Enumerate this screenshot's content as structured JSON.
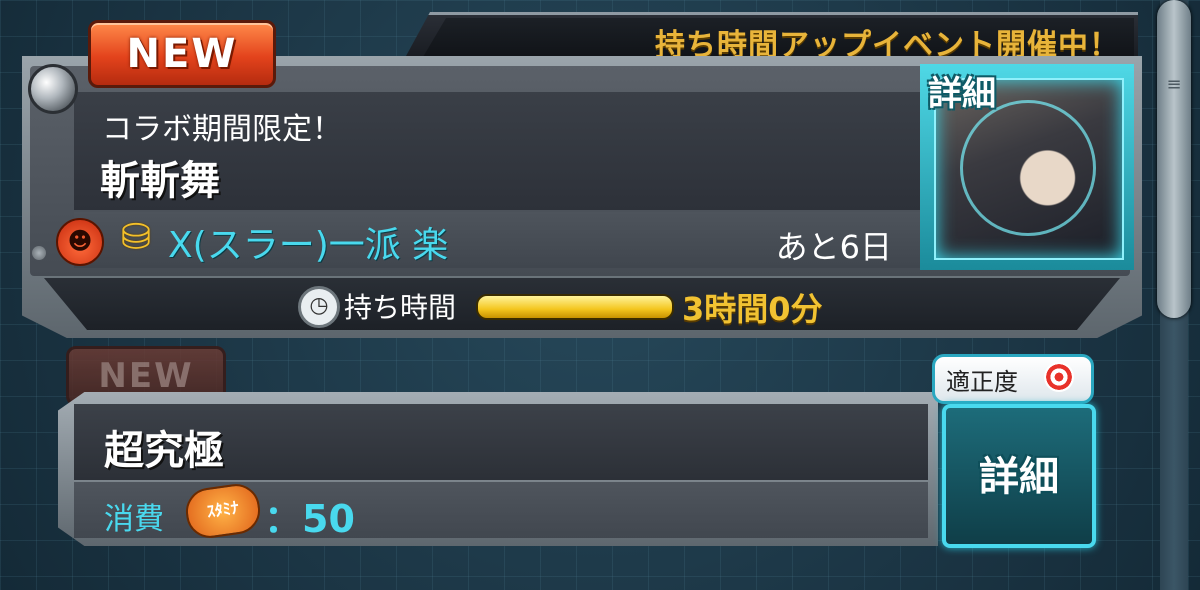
{
  "event_banner": {
    "text": "持ち時間アップイベント開催中！"
  },
  "quest_card_1": {
    "new_badge": "NEW",
    "subtitle": "コラボ期間限定！",
    "title": "斬斬舞",
    "group": "X(スラー)一派 楽",
    "remaining": "あと6日",
    "detail_label": "詳細",
    "time_label": "持ち時間",
    "time_value": "3時間0分",
    "time_fill": 1.0
  },
  "quest_card_2": {
    "new_badge": "NEW",
    "title": "超究極",
    "cost_label": "消費",
    "stamina_icon_text": "ｽﾀﾐﾅ",
    "cost_value": "：50",
    "aptitude_label": "適正度",
    "detail_label": "詳細"
  },
  "colors": {
    "accent_cyan": "#49d9ee",
    "gold": "#f1c232",
    "new_red": "#e3431c"
  }
}
